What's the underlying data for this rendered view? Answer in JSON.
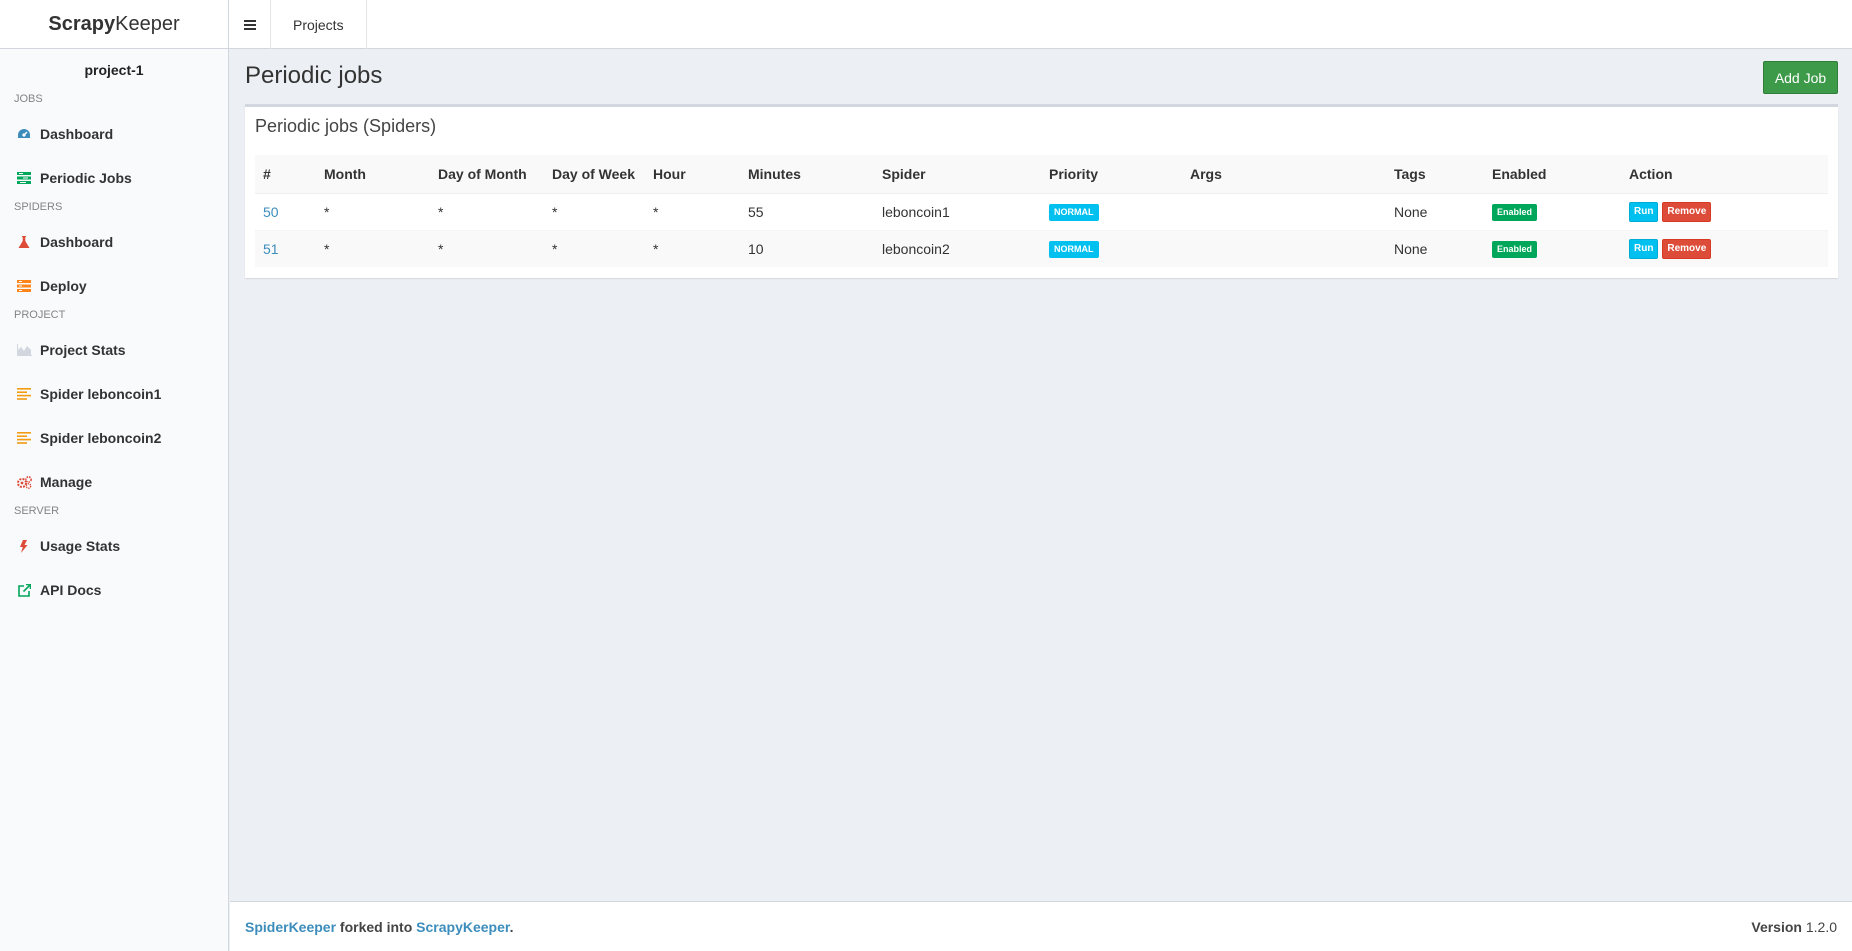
{
  "header": {
    "logo_bold": "Scrapy",
    "logo_rest": "Keeper",
    "nav_projects": "Projects"
  },
  "sidebar": {
    "project": "project-1",
    "sections": [
      {
        "title": "JOBS",
        "items": [
          {
            "label": "Dashboard",
            "icon": "dashboard-icon",
            "color": "#3c8dbc"
          },
          {
            "label": "Periodic Jobs",
            "icon": "tasks-icon",
            "color": "#00a65a"
          }
        ]
      },
      {
        "title": "SPIDERS",
        "items": [
          {
            "label": "Dashboard",
            "icon": "flask-icon",
            "color": "#dd4b39"
          },
          {
            "label": "Deploy",
            "icon": "server-icon",
            "color": "#ff851b"
          }
        ]
      },
      {
        "title": "PROJECT",
        "items": [
          {
            "label": "Project Stats",
            "icon": "area-chart-icon",
            "color": "#d2d6de"
          },
          {
            "label": "Spider leboncoin1",
            "icon": "list-icon",
            "color": "#f39c12"
          },
          {
            "label": "Spider leboncoin2",
            "icon": "list-icon",
            "color": "#f39c12"
          },
          {
            "label": "Manage",
            "icon": "cogs-icon",
            "color": "#dd4b39"
          }
        ]
      },
      {
        "title": "SERVER",
        "items": [
          {
            "label": "Usage Stats",
            "icon": "bolt-icon",
            "color": "#dd4b39"
          },
          {
            "label": "API Docs",
            "icon": "external-link-icon",
            "color": "#00a65a"
          }
        ]
      }
    ]
  },
  "main": {
    "title": "Periodic jobs",
    "add_job": "Add Job",
    "box_title": "Periodic jobs (Spiders)",
    "columns": [
      "#",
      "Month",
      "Day of Month",
      "Day of Week",
      "Hour",
      "Minutes",
      "Spider",
      "Priority",
      "Args",
      "Tags",
      "Enabled",
      "Action"
    ],
    "rows": [
      {
        "id": "50",
        "month": "*",
        "dom": "*",
        "dow": "*",
        "hour": "*",
        "minutes": "55",
        "spider": "leboncoin1",
        "priority": "NORMAL",
        "args": "",
        "tags": "None",
        "enabled": "Enabled",
        "run": "Run",
        "remove": "Remove"
      },
      {
        "id": "51",
        "month": "*",
        "dom": "*",
        "dow": "*",
        "hour": "*",
        "minutes": "10",
        "spider": "leboncoin2",
        "priority": "NORMAL",
        "args": "",
        "tags": "None",
        "enabled": "Enabled",
        "run": "Run",
        "remove": "Remove"
      }
    ]
  },
  "footer": {
    "link1": "SpiderKeeper",
    "middle": " forked into ",
    "link2": "ScrapyKeeper",
    "end": ".",
    "version_label": "Version",
    "version": "1.2.0"
  }
}
